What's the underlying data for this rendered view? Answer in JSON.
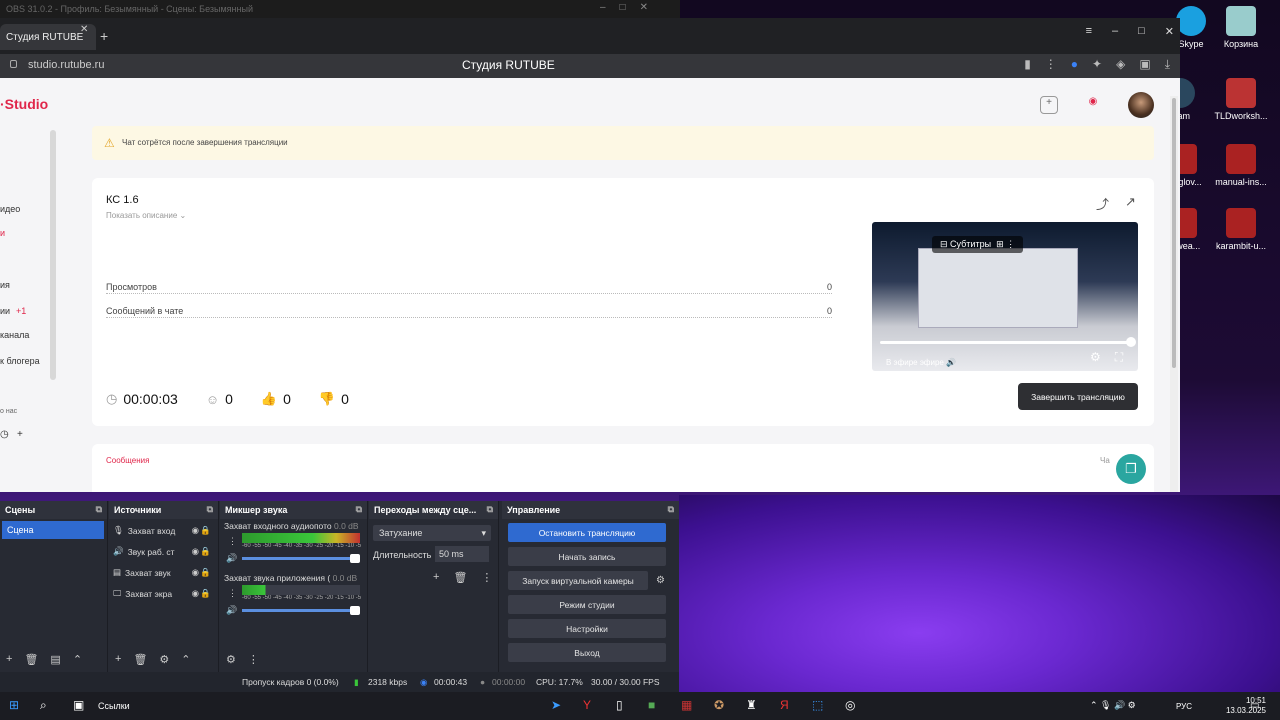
{
  "obs": {
    "window_title": "OBS 31.0.2 - Профиль: Безымянный - Сцены: Безымянный",
    "scenes": {
      "header": "Сцены",
      "items": [
        "Сцена"
      ]
    },
    "sources": {
      "header": "Источники",
      "items": [
        "Захват вход",
        "Звук раб. ст",
        "Захват звук",
        "Захват экра"
      ]
    },
    "mixer": {
      "header": "Микшер звука",
      "channels": [
        {
          "name": "Захват входного аудиопото",
          "level": "0.0 dB",
          "scale": "-60 -55 -50 -45 -40 -35 -30 -25 -20 -15 -10 -5 0"
        },
        {
          "name": "Захват звука приложения (",
          "level": "0.0 dB",
          "scale": "-60 -55 -50 -45 -40 -35 -30 -25 -20 -15 -10 -5 0"
        }
      ]
    },
    "transitions": {
      "header": "Переходы между сце...",
      "selected": "Затухание",
      "duration_label": "Длительность",
      "duration_value": "50 ms"
    },
    "controls": {
      "header": "Управление",
      "stop_stream": "Остановить трансляцию",
      "start_record": "Начать запись",
      "virtual_cam": "Запуск виртуальной камеры",
      "studio_mode": "Режим студии",
      "settings": "Настройки",
      "exit": "Выход"
    },
    "status": {
      "dropped": "Пропуск кадров 0 (0.0%)",
      "bitrate": "2318 kbps",
      "stream_time": "00:00:43",
      "rec_time": "00:00:00",
      "cpu": "CPU: 17.7%",
      "fps": "30.00 / 30.00 FPS"
    }
  },
  "browser": {
    "tab_title": "Студия RUTUBE",
    "url": "studio.rutube.ru",
    "page_title": "Студия RUTUBE"
  },
  "studio": {
    "logo": "Studio",
    "sidebar": [
      "идео",
      "и",
      "ия",
      "ии",
      "+1",
      "канала",
      "к блогера",
      "о нас"
    ],
    "banner": "Чат сотрётся после завершения трансляции",
    "stream": {
      "title": "КС 1.6",
      "show_desc": "Показать описание",
      "views_label": "Просмотров",
      "views_value": "0",
      "chat_label": "Сообщений в чате",
      "chat_value": "0",
      "duration": "00:00:03",
      "viewers": "0",
      "likes": "0",
      "dislikes": "0",
      "end_button": "Завершить трансляцию"
    },
    "player": {
      "subtitles": "Субтитры",
      "live": "В эфире",
      "live_overlay": "эфире"
    },
    "chat_tab": "Сообщения",
    "chat_right": "Ча"
  },
  "desktop": {
    "icons": [
      {
        "label": "Skype",
        "color": "#1aa0e0"
      },
      {
        "label": "Корзина",
        "color": "#9cc"
      },
      {
        "label": "team",
        "color": "#2a475e"
      },
      {
        "label": "TLDworksh...",
        "color": "#b33"
      },
      {
        "label": "fort-glov...",
        "color": "#a22"
      },
      {
        "label": "manual-ins...",
        "color": "#a22"
      },
      {
        "label": "ult-wea...",
        "color": "#a22"
      },
      {
        "label": "karambit-u...",
        "color": "#a22"
      }
    ]
  },
  "taskbar": {
    "search": "Ссылки",
    "lang": "РУС",
    "time": "10:51",
    "date": "13.03.2025"
  }
}
